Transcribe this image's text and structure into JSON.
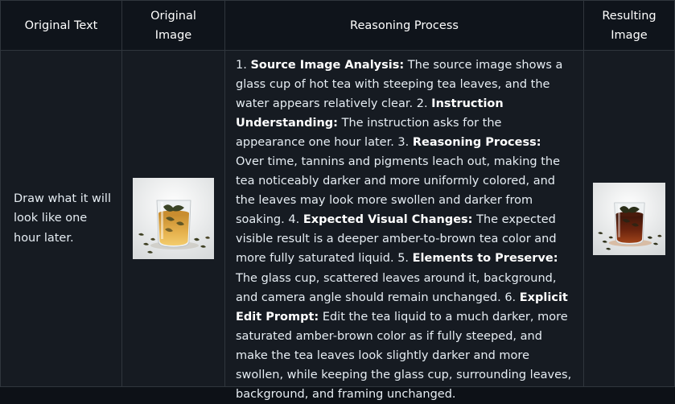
{
  "table": {
    "headers": {
      "original_text": "Original Text",
      "original_image": "Original\nImage",
      "reasoning_process": "Reasoning Process",
      "resulting_image": "Resulting\nImage"
    },
    "row": {
      "original_text": "Draw what it will look like one hour later.",
      "original_image_alt": "glass cup of hot tea with steeping tea leaves",
      "resulting_image_alt": "glass cup of darker amber-brown steeped tea",
      "reasoning_steps": [
        {
          "num": "1.",
          "title": "Source Image Analysis:",
          "text": "The source image shows a glass cup of hot tea with steeping tea leaves, and the water appears relatively clear."
        },
        {
          "num": "2.",
          "title": "Instruction Understanding:",
          "text": "The instruction asks for the appearance one hour later."
        },
        {
          "num": "3.",
          "title": "Reasoning Process:",
          "text": "Over time, tannins and pigments leach out, making the tea noticeably darker and more uniformly colored, and the leaves may look more swollen and darker from soaking."
        },
        {
          "num": "4.",
          "title": "Expected Visual Changes:",
          "text": "The expected visible result is a deeper amber-to-brown tea color and more fully saturated liquid."
        },
        {
          "num": "5.",
          "title": "Elements to Preserve:",
          "text": "The glass cup, scattered leaves around it, background, and camera angle should remain unchanged."
        },
        {
          "num": "6.",
          "title": "Explicit Edit Prompt:",
          "text": "Edit the tea liquid to a much darker, more saturated amber-brown color as if fully steeped, and make the tea leaves look slightly darker and more swollen, while keeping the glass cup, surrounding leaves, background, and framing unchanged."
        }
      ]
    }
  },
  "colors": {
    "background": "#161b22",
    "header_background": "#0f141b",
    "border": "#30363d",
    "text": "#e6edf3",
    "tea_original": "#d8a23e",
    "tea_result": "#7a2a10"
  }
}
